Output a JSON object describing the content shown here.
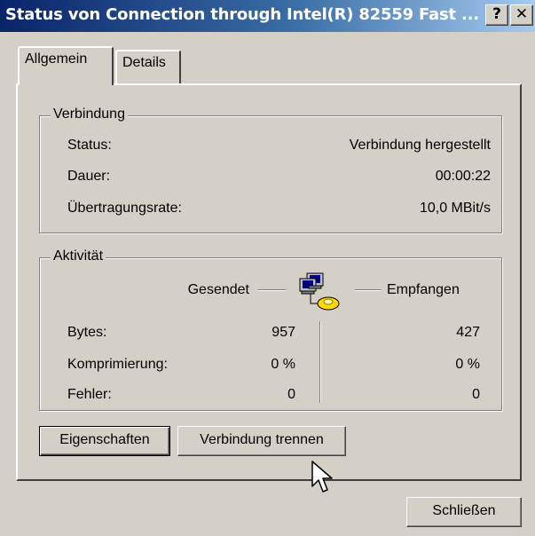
{
  "window": {
    "title": "Status von Connection through Intel(R) 82559 Fast ...",
    "help_button": "?",
    "close_button": "✕"
  },
  "tabs": [
    {
      "label": "Allgemein",
      "active": true
    },
    {
      "label": "Details",
      "active": false
    }
  ],
  "connection": {
    "legend": "Verbindung",
    "rows": [
      {
        "label": "Status:",
        "value": "Verbindung hergestellt"
      },
      {
        "label": "Dauer:",
        "value": "00:00:22"
      },
      {
        "label": "Übertragungsrate:",
        "value": "10,0 MBit/s"
      }
    ]
  },
  "activity": {
    "legend": "Aktivität",
    "sent_label": "Gesendet",
    "received_label": "Empfangen",
    "rows": [
      {
        "label": "Bytes:",
        "sent": "957",
        "received": "427"
      },
      {
        "label": "Komprimierung:",
        "sent": "0 %",
        "received": "0 %"
      },
      {
        "label": "Fehler:",
        "sent": "0",
        "received": "0"
      }
    ]
  },
  "buttons": {
    "properties": "Eigenschaften",
    "disconnect": "Verbindung trennen",
    "close": "Schließen"
  },
  "icons": {
    "network": "network-computers-icon",
    "cursor": "mouse-cursor-icon"
  }
}
